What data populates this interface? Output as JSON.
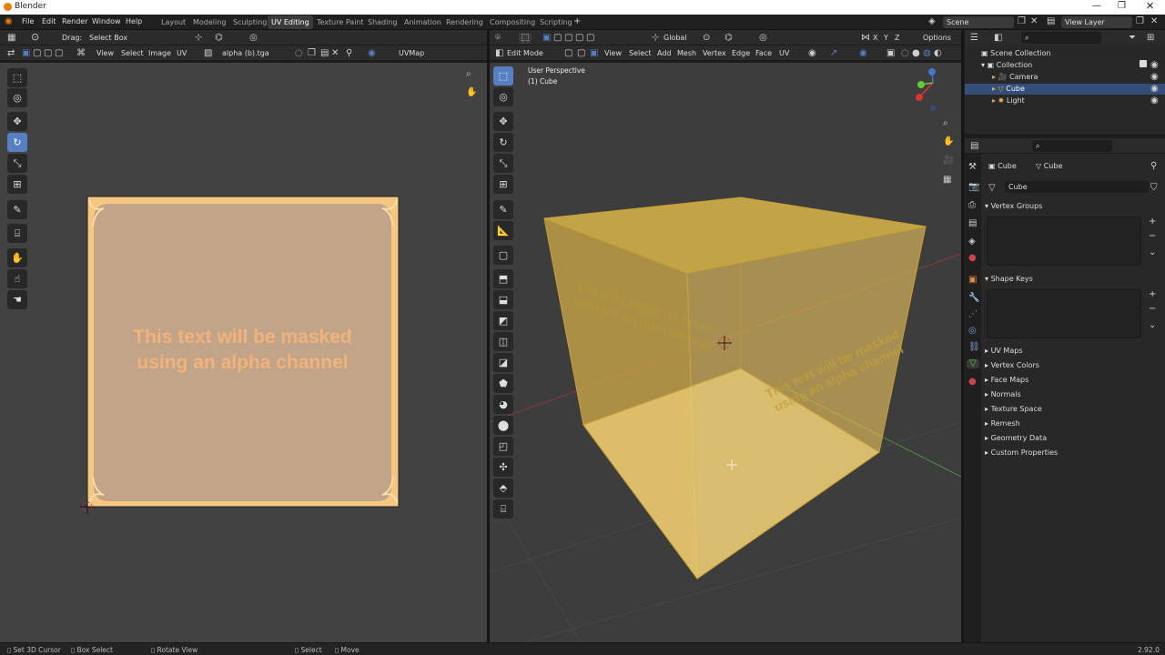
{
  "app": {
    "title": "Blender",
    "version": "2.92.0"
  },
  "menu": [
    "File",
    "Edit",
    "Render",
    "Window",
    "Help"
  ],
  "workspaces": [
    "Layout",
    "Modeling",
    "Sculpting",
    "UV Editing",
    "Texture Paint",
    "Shading",
    "Animation",
    "Rendering",
    "Compositing",
    "Scripting"
  ],
  "active_workspace": "UV Editing",
  "scene": {
    "name": "Scene",
    "view_layer": "View Layer"
  },
  "uv_editor": {
    "drag_label": "Drag:",
    "drag_value": "Select Box",
    "menus": [
      "View",
      "Select",
      "Image",
      "UV"
    ],
    "image_name": "alpha (b).tga",
    "uvmap": "UVMap",
    "image_text_line1": "This text will be masked",
    "image_text_line2": "using an alpha channel"
  },
  "viewport": {
    "mode": "Edit Mode",
    "menus": [
      "View",
      "Select",
      "Add",
      "Mesh",
      "Vertex",
      "Edge",
      "Face",
      "UV"
    ],
    "orientation": "Global",
    "axes": [
      "X",
      "Y",
      "Z"
    ],
    "options": "Options",
    "overlay_line1": "User Perspective",
    "overlay_line2": "(1) Cube",
    "cube_text_line1": "This text will be masked",
    "cube_text_line2": "using an alpha channel"
  },
  "outliner": {
    "root": "Scene Collection",
    "collection": "Collection",
    "items": [
      "Camera",
      "Cube",
      "Light"
    ],
    "selected": "Cube"
  },
  "properties": {
    "object": "Cube",
    "mesh": "Cube",
    "mesh_data": "Cube",
    "panels": {
      "vertex_groups": "Vertex Groups",
      "shape_keys": "Shape Keys"
    },
    "subpanels": [
      "UV Maps",
      "Vertex Colors",
      "Face Maps",
      "Normals",
      "Texture Space",
      "Remesh",
      "Geometry Data",
      "Custom Properties"
    ]
  },
  "status": {
    "set_cursor": "Set 3D Cursor",
    "box_select": "Box Select",
    "rotate_view": "Rotate View",
    "select": "Select",
    "move": "Move"
  },
  "colors": {
    "accent": "#5680c2",
    "cube_fill": "#e8c14c",
    "uv_border": "#f6c780",
    "text_orange": "#f2b27a"
  }
}
